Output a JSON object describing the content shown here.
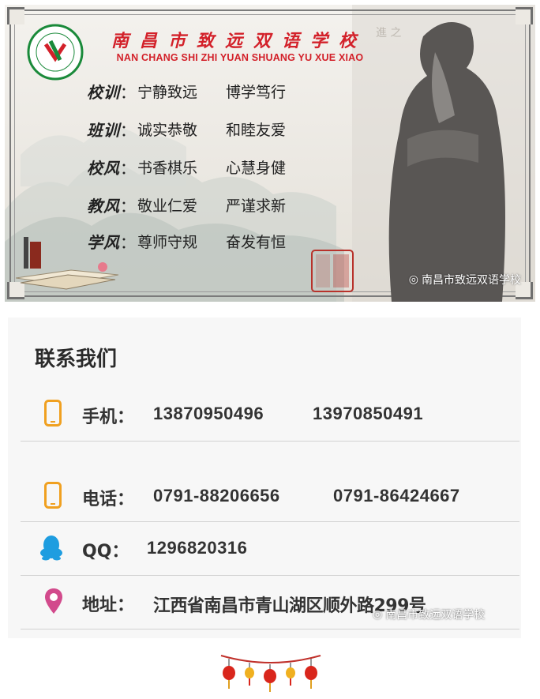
{
  "banner": {
    "school_name": "南昌市致远双语学校",
    "school_name_pinyin": "NAN CHANG SHI ZHI YUAN SHUANG YU XUE XIAO",
    "logo_text": "南昌市致远双语学校",
    "mottos": [
      {
        "label": "校训",
        "phrase1": "宁静致远",
        "phrase2": "博学笃行"
      },
      {
        "label": "班训",
        "phrase1": "诚实恭敬",
        "phrase2": "和睦友爱"
      },
      {
        "label": "校风",
        "phrase1": "书香棋乐",
        "phrase2": "心慧身健"
      },
      {
        "label": "教风",
        "phrase1": "敬业仁爱",
        "phrase2": "严谨求新"
      },
      {
        "label": "学风",
        "phrase1": "尊师守规",
        "phrase2": "奋发有恒"
      }
    ],
    "separator": "：",
    "watermark": "南昌市致远双语学校"
  },
  "contact": {
    "title": "联系我们",
    "rows": [
      {
        "icon": "mobile-phone-icon",
        "key": "手机：",
        "value1": "13870950496",
        "value2": "13970850491"
      },
      {
        "icon": "phone-icon",
        "key": "电话：",
        "value1": "0791-88206656",
        "value2": "0791-86424667"
      },
      {
        "icon": "qq-penguin-icon",
        "key": "QQ：",
        "value1": "1296820316",
        "value2": ""
      },
      {
        "icon": "location-pin-icon",
        "key": "地址：",
        "value1": "江西省南昌市青山湖区顺外路299号",
        "value2": ""
      }
    ],
    "watermark": "南昌市致远双语学校"
  },
  "colors": {
    "title_red": "#d3212a",
    "icon_orange": "#f0a020",
    "qq_blue": "#1e9de0",
    "pin_pink": "#d24a8c"
  }
}
